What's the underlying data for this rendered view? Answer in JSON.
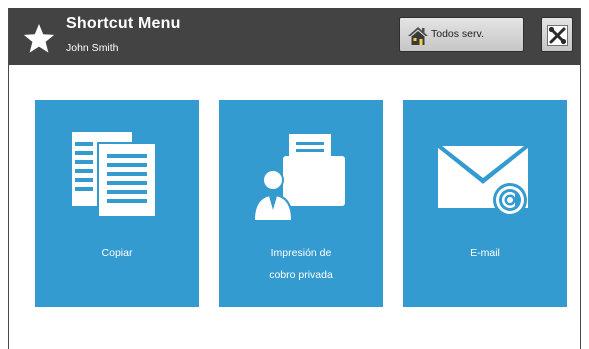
{
  "header": {
    "title": "Shortcut Menu",
    "user": "John Smith",
    "icon": "star-icon",
    "home_button": {
      "label": "Todos serv.",
      "icon": "home-icon"
    },
    "tools_button": {
      "icon": "tools-icon"
    }
  },
  "tiles": [
    {
      "label_lines": [
        "Copiar"
      ],
      "icon": "copy-icon"
    },
    {
      "label_lines": [
        "Impresión de",
        "cobro privada"
      ],
      "icon": "private-print-icon"
    },
    {
      "label_lines": [
        "E-mail"
      ],
      "icon": "email-icon"
    }
  ],
  "colors": {
    "header_bg": "#434343",
    "tile_bg": "#349bd0",
    "text_light": "#ffffff"
  }
}
